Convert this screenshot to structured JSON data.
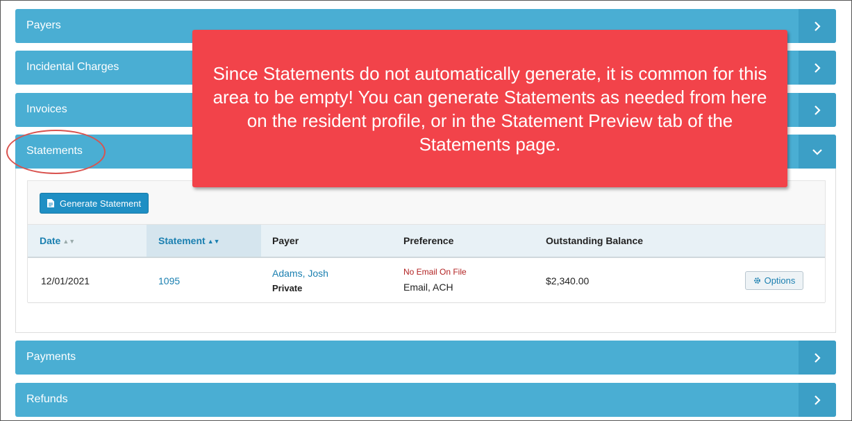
{
  "accordion": {
    "payers": "Payers",
    "incidental_charges": "Incidental Charges",
    "invoices": "Invoices",
    "statements": "Statements",
    "payments": "Payments",
    "refunds": "Refunds"
  },
  "callout": {
    "text": "Since Statements do not automatically generate, it is common for this area to be empty! You can generate Statements as needed from here on the resident profile, or in the Statement Preview tab of the Statements page."
  },
  "statements": {
    "generate_button": "Generate Statement",
    "columns": {
      "date": "Date",
      "statement": "Statement",
      "payer": "Payer",
      "preference": "Preference",
      "outstanding_balance": "Outstanding Balance"
    },
    "rows": [
      {
        "date": "12/01/2021",
        "statement": "1095",
        "payer_name": "Adams, Josh",
        "payer_type": "Private",
        "preference_warning": "No Email On File",
        "preference": "Email, ACH",
        "balance": "$2,340.00",
        "options_label": "Options"
      }
    ]
  },
  "colors": {
    "accordion": "#4aaed3",
    "callout": "#f2434a",
    "highlight_ring": "#d9534f",
    "link": "#1a7fb0",
    "warning": "#b22222"
  }
}
